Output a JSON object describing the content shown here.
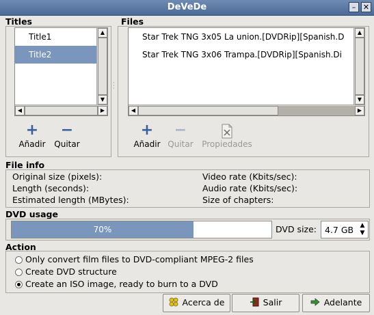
{
  "window": {
    "title": "DeVeDe",
    "minimize_glyph": "–",
    "close_glyph": "✕"
  },
  "titles": {
    "label": "Titles",
    "items": [
      "Title1",
      "Title2"
    ],
    "selected_index": 1,
    "add_label": "Añadir",
    "remove_label": "Quitar"
  },
  "files": {
    "label": "Files",
    "items": [
      "Star Trek TNG 3x05 La union.[DVDRip][Spanish.D",
      "Star Trek TNG 3x06 Trampa.[DVDRip][Spanish.Di"
    ],
    "add_label": "Añadir",
    "remove_label": "Quitar",
    "properties_label": "Propiedades"
  },
  "file_info": {
    "label": "File info",
    "original_size": "Original size (pixels):",
    "length": "Length (seconds):",
    "estimated_length": "Estimated length (MBytes):",
    "video_rate": "Video rate (Kbits/sec):",
    "audio_rate": "Audio rate (Kbits/sec):",
    "chapter_size": "Size of chapters:"
  },
  "dvd_usage": {
    "label": "DVD usage",
    "percent_text": "70%",
    "fraction": 0.7,
    "size_label": "DVD size:",
    "size_value": "4.7 GB"
  },
  "action": {
    "label": "Action",
    "options": [
      "Only convert film files to DVD-compliant MPEG-2 files",
      "Create DVD structure",
      "Create an ISO image, ready to burn to a DVD"
    ],
    "selected_index": 2
  },
  "buttons": {
    "about_label": "Acerca de",
    "exit_label": "Salir",
    "forward_label": "Adelante"
  },
  "icons": {
    "add": "plus-icon",
    "remove": "minus-icon",
    "properties": "document-icon",
    "about": "stars-icon",
    "exit": "exit-icon",
    "forward": "arrow-right-icon"
  },
  "colors": {
    "accent": "#7a96bd",
    "titlebar": "#5b78a5"
  }
}
